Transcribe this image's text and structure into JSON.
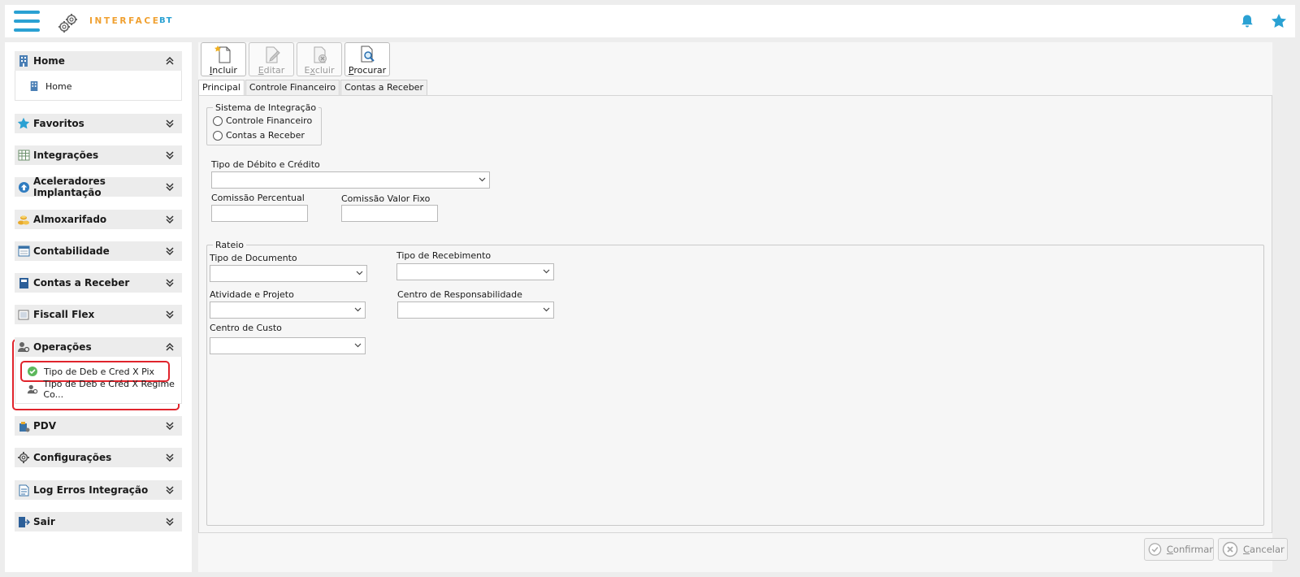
{
  "header": {
    "logo_text": "INTERFACE",
    "logo_suffix": "BT",
    "menu_icon": "hamburger-icon",
    "notification_icon": "bell-icon",
    "favorite_icon": "star-icon",
    "accent_color": "#2aa1d3",
    "logo_color": "#f0a030"
  },
  "sidebar": {
    "sections": [
      {
        "label": "Home",
        "icon": "building-icon",
        "expanded": true,
        "items": [
          {
            "label": "Home",
            "icon": "building-icon"
          }
        ]
      },
      {
        "label": "Favoritos",
        "icon": "star-icon",
        "expanded": false
      },
      {
        "label": "Integrações",
        "icon": "table-icon",
        "expanded": false
      },
      {
        "label": "Aceleradores Implantação",
        "icon": "upload-icon",
        "expanded": false
      },
      {
        "label": "Almoxarifado",
        "icon": "coins-icon",
        "expanded": false
      },
      {
        "label": "Contabilidade",
        "icon": "ledger-icon",
        "expanded": false
      },
      {
        "label": "Contas a Receber",
        "icon": "book-icon",
        "expanded": false
      },
      {
        "label": "Fiscall Flex",
        "icon": "box-icon",
        "expanded": false
      },
      {
        "label": "Operações",
        "icon": "user-gear-icon",
        "expanded": true,
        "items": [
          {
            "label": "Tipo de Deb e Cred X Pix",
            "icon": "check-icon"
          },
          {
            "label": "Tipo de Deb e Créd X Regime Co...",
            "icon": "user-gear-icon"
          }
        ]
      },
      {
        "label": "PDV",
        "icon": "shop-icon",
        "expanded": false
      },
      {
        "label": "Configurações",
        "icon": "gear-icon",
        "expanded": false
      },
      {
        "label": "Log Erros Integração",
        "icon": "document-icon",
        "expanded": false
      },
      {
        "label": "Sair",
        "icon": "exit-icon",
        "expanded": false
      }
    ]
  },
  "toolbar": {
    "buttons": [
      {
        "label": "Incluir",
        "underline": "I",
        "rest": "ncluir",
        "enabled": true
      },
      {
        "label": "Editar",
        "underline": "E",
        "rest": "ditar",
        "enabled": false
      },
      {
        "label": "Excluir",
        "underline": "x",
        "prefix": "E",
        "rest": "cluir",
        "enabled": false
      },
      {
        "label": "Procurar",
        "underline": "P",
        "rest": "rocurar",
        "enabled": true
      }
    ]
  },
  "tabs": [
    "Principal",
    "Controle Financeiro",
    "Contas a Receber"
  ],
  "form": {
    "integration_group": {
      "legend": "Sistema de Integração",
      "options": [
        "Controle Financeiro",
        "Contas a Receber"
      ]
    },
    "debit_credit_type_label": "Tipo de Débito e Crédito",
    "commission_percent_label": "Comissão Percentual",
    "commission_fixed_label": "Comissão Valor Fixo",
    "rateio": {
      "legend": "Rateio",
      "document_type_label": "Tipo de Documento",
      "receipt_type_label": "Tipo de Recebimento",
      "activity_project_label": "Atividade e Projeto",
      "responsibility_center_label": "Centro de Responsabilidade",
      "cost_center_label": "Centro de Custo"
    }
  },
  "footer": {
    "confirm_label": "Confirmar",
    "confirm_underline": "C",
    "confirm_rest": "onfirmar",
    "cancel_label": "Cancelar",
    "cancel_underline": "C",
    "cancel_rest": "ancelar"
  }
}
